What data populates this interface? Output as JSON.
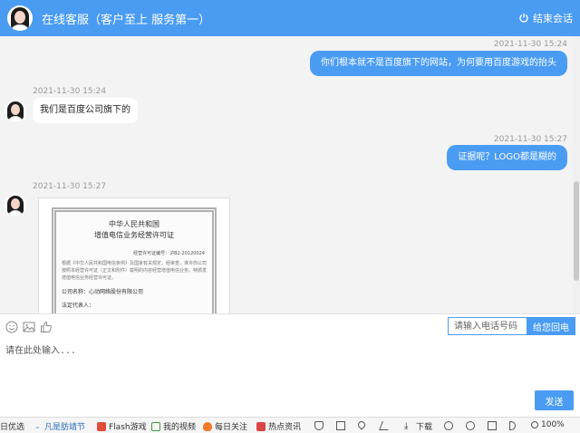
{
  "header": {
    "title": "在线客服（客户至上 服务第一）",
    "end_label": "结束会话"
  },
  "messages": [
    {
      "side": "right",
      "time": "2021-11-30 15:24",
      "text": "你们根本就不是百度旗下的网站，为何要用百度游戏的抬头"
    },
    {
      "side": "left",
      "time": "2021-11-30 15:24",
      "text": "我们是百度公司旗下的"
    },
    {
      "side": "right",
      "time": "2021-11-30 15:27",
      "text": "证据呢？LOGO都是糊的"
    },
    {
      "side": "left",
      "time": "2021-11-30 15:27",
      "image": "license"
    }
  ],
  "license": {
    "title_line1": "中华人民共和国",
    "title_line2": "增值电信业务经营许可证",
    "number": "经营许可证编号：沪B2-20120024",
    "body": "根据《中华人民共和国电信条例》及国家有关规定，经审查，准许你公司按照本经营许可证（正文和附件）载明的内容经营增值电信业务。特颁发增值电信业务经营许可证。",
    "company_label": "公司名称：",
    "company_name": "心动网络股份有限公司",
    "legal_label": "法定代表人："
  },
  "toolbar": {
    "icons": [
      "emoji-icon",
      "image-icon",
      "thumbs-up-icon"
    ],
    "phone_placeholder": "请输入电话号码",
    "callback_label": "给您回电"
  },
  "composer": {
    "placeholder": "请在此处输入...",
    "send_label": "发送"
  },
  "statusbar": {
    "items": [
      "日优选",
      "凡是肪靖节",
      "Flash游戏",
      "我的视频",
      "每日关注",
      "热点资讯",
      "下载"
    ],
    "zoom": "100%"
  },
  "colors": {
    "accent": "#4a9cf3",
    "background": "#f3f3f3"
  }
}
